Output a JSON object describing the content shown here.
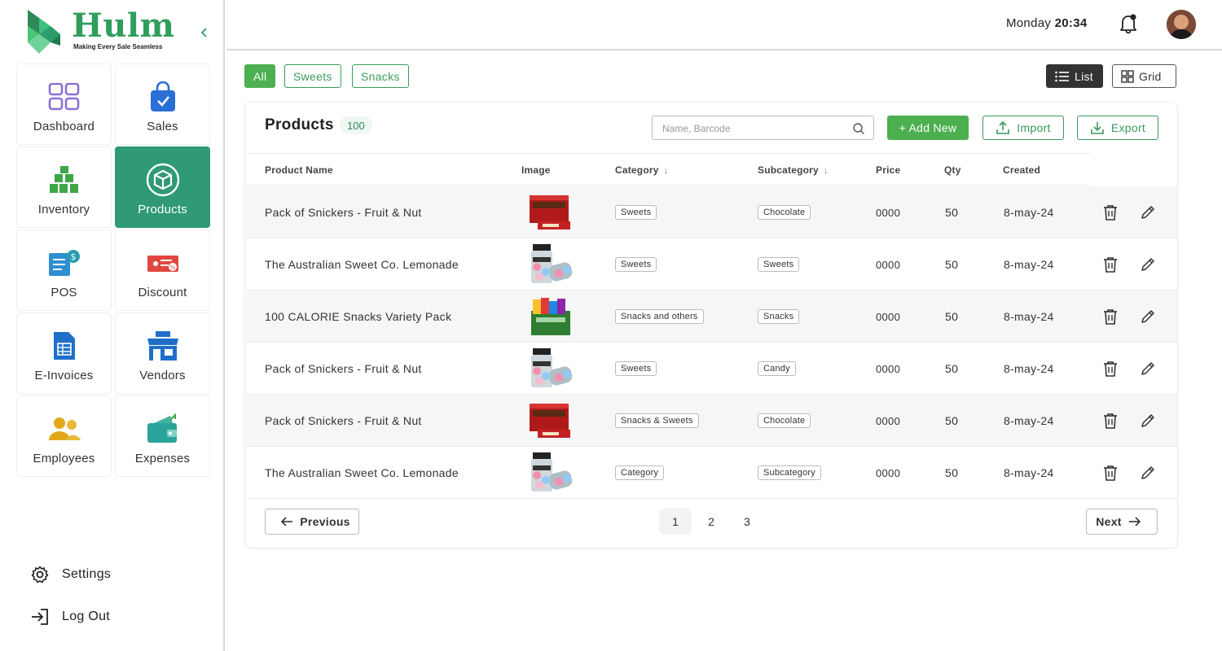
{
  "brand": {
    "name": "Hulm",
    "tagline": "Making Every Sale Seamless",
    "color": "#2f9e5c"
  },
  "nav": {
    "tiles": [
      {
        "label": "Dashboard",
        "icon": "dashboard-grid-icon"
      },
      {
        "label": "Sales",
        "icon": "shopping-bag-icon"
      },
      {
        "label": "Inventory",
        "icon": "boxes-icon"
      },
      {
        "label": "Products",
        "icon": "product-box-icon",
        "active": true
      },
      {
        "label": "POS",
        "icon": "pos-receipt-icon"
      },
      {
        "label": "Discount",
        "icon": "discount-ticket-icon"
      },
      {
        "label": "E-Invoices",
        "icon": "invoice-icon"
      },
      {
        "label": "Vendors",
        "icon": "storefront-icon"
      },
      {
        "label": "Employees",
        "icon": "employees-icon"
      },
      {
        "label": "Expenses",
        "icon": "wallet-icon"
      }
    ],
    "settings": "Settings",
    "logout": "Log Out"
  },
  "header": {
    "day": "Monday",
    "time": "20:34"
  },
  "filters": {
    "all": "All",
    "sweets": "Sweets",
    "snacks": "Snacks"
  },
  "view": {
    "list": "List",
    "grid": "Grid"
  },
  "products": {
    "title": "Products",
    "count": "100",
    "search_placeholder": "Name, Barcode",
    "add_new": "+ Add New",
    "import": "Import",
    "export": "Export",
    "columns": {
      "name": "Product Name",
      "image": "Image",
      "category": "Category",
      "subcategory": "Subcategory",
      "price": "Price",
      "qty": "Qty",
      "created": "Created"
    },
    "rows": [
      {
        "name": "Pack of Snickers - Fruit & Nut",
        "image": "snickers",
        "category": "Sweets",
        "subcategory": "Chocolate",
        "price": "0000",
        "qty": "50",
        "created": "8-may-24"
      },
      {
        "name": "The Australian Sweet Co. Lemonade",
        "image": "jar",
        "category": "Sweets",
        "subcategory": "Sweets",
        "price": "0000",
        "qty": "50",
        "created": "8-may-24"
      },
      {
        "name": "100 CALORIE Snacks Variety Pack",
        "image": "variety",
        "category": "Snacks and others",
        "subcategory": "Snacks",
        "price": "0000",
        "qty": "50",
        "created": "8-may-24"
      },
      {
        "name": "Pack of Snickers - Fruit & Nut",
        "image": "jar",
        "category": "Sweets",
        "subcategory": "Candy",
        "price": "0000",
        "qty": "50",
        "created": "8-may-24"
      },
      {
        "name": "Pack of Snickers - Fruit & Nut",
        "image": "snickers",
        "category": "Snacks & Sweets",
        "subcategory": "Chocolate",
        "price": "0000",
        "qty": "50",
        "created": "8-may-24"
      },
      {
        "name": "The Australian Sweet Co. Lemonade",
        "image": "jar",
        "category": "Category",
        "subcategory": "Subcategory",
        "price": "0000",
        "qty": "50",
        "created": "8-may-24"
      }
    ]
  },
  "pagination": {
    "previous": "Previous",
    "next": "Next",
    "pages": [
      "1",
      "2",
      "3"
    ],
    "current": "1"
  }
}
